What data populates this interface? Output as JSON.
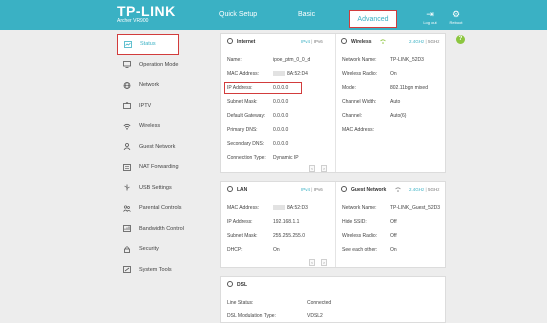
{
  "header": {
    "logo": "TP-LINK",
    "model": "Archer VR900",
    "tabs": [
      "Quick Setup",
      "Basic",
      "Advanced"
    ],
    "logout": "Log out",
    "reboot": "Reboot"
  },
  "sidebar": {
    "items": [
      {
        "label": "Status",
        "icon": "status-icon"
      },
      {
        "label": "Operation Mode",
        "icon": "monitor-icon"
      },
      {
        "label": "Network",
        "icon": "globe-icon"
      },
      {
        "label": "IPTV",
        "icon": "tv-icon"
      },
      {
        "label": "Wireless",
        "icon": "wifi-icon"
      },
      {
        "label": "Guest Network",
        "icon": "guest-icon"
      },
      {
        "label": "NAT Forwarding",
        "icon": "nat-icon"
      },
      {
        "label": "USB Settings",
        "icon": "usb-icon"
      },
      {
        "label": "Parental Controls",
        "icon": "parental-icon"
      },
      {
        "label": "Bandwidth Control",
        "icon": "bandwidth-icon"
      },
      {
        "label": "Security",
        "icon": "lock-icon"
      },
      {
        "label": "System Tools",
        "icon": "tools-icon"
      }
    ]
  },
  "internet": {
    "title": "Internet",
    "ipv4": "IPv4",
    "ipv6": "IPv6",
    "rows": [
      {
        "label": "Name:",
        "value": "ipoe_ptm_0_0_d"
      },
      {
        "label": "MAC Address:",
        "value": "8A:52:D4"
      },
      {
        "label": "IP Address:",
        "value": "0.0.0.0"
      },
      {
        "label": "Subnet Mask:",
        "value": "0.0.0.0"
      },
      {
        "label": "Default Gateway:",
        "value": "0.0.0.0"
      },
      {
        "label": "Primary DNS:",
        "value": "0.0.0.0"
      },
      {
        "label": "Secondary DNS:",
        "value": "0.0.0.0"
      },
      {
        "label": "Connection Type:",
        "value": "Dynamic IP"
      }
    ]
  },
  "wireless": {
    "title": "Wireless",
    "band_a": "2.4GHz",
    "band_b": "5GHz",
    "rows": [
      {
        "label": "Network Name:",
        "value": "TP-LINK_52D3"
      },
      {
        "label": "Wireless Radio:",
        "value": "On"
      },
      {
        "label": "Mode:",
        "value": "802.11bgn mixed"
      },
      {
        "label": "Channel Width:",
        "value": "Auto"
      },
      {
        "label": "Channel:",
        "value": "Auto(6)"
      },
      {
        "label": "MAC Address:",
        "value": ""
      }
    ]
  },
  "lan": {
    "title": "LAN",
    "ipv4": "IPv4",
    "ipv6": "IPv6",
    "rows": [
      {
        "label": "MAC Address:",
        "value": "8A:52:D3"
      },
      {
        "label": "IP Address:",
        "value": "192.168.1.1"
      },
      {
        "label": "Subnet Mask:",
        "value": "255.255.255.0"
      },
      {
        "label": "DHCP:",
        "value": "On"
      }
    ]
  },
  "guest": {
    "title": "Guest Network",
    "band_a": "2.4GHz",
    "band_b": "5GHz",
    "rows": [
      {
        "label": "Network Name:",
        "value": "TP-LINK_Guest_52D3"
      },
      {
        "label": "Hide SSID:",
        "value": "Off"
      },
      {
        "label": "Wireless Radio:",
        "value": "Off"
      },
      {
        "label": "See each other:",
        "value": "On"
      }
    ]
  },
  "dsl": {
    "title": "DSL",
    "rows": [
      {
        "label": "Line Status:",
        "value": "Connected"
      },
      {
        "label": "DSL Modulation Type:",
        "value": "VDSL2"
      }
    ]
  },
  "pager": {
    "prev": "<",
    "next": ">"
  },
  "help": "?",
  "colors": {
    "header": "#3ab1c4",
    "highlight": "#d23c3c",
    "help": "#8cc63f"
  }
}
